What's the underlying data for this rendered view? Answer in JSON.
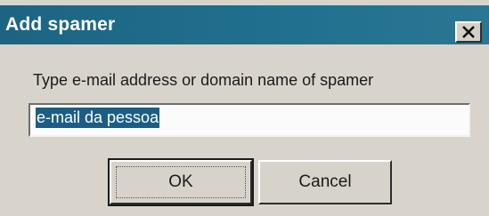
{
  "window": {
    "title": "Add spamer",
    "close_icon": "close-icon"
  },
  "form": {
    "prompt_label": "Type e-mail address or domain name of spamer",
    "input_value": "e-mail da pessoa"
  },
  "buttons": {
    "ok_label": "OK",
    "cancel_label": "Cancel"
  },
  "colors": {
    "titlebar": "#1d6483",
    "selection": "#1c5d86",
    "dialog_bg": "#d9d4cb"
  }
}
